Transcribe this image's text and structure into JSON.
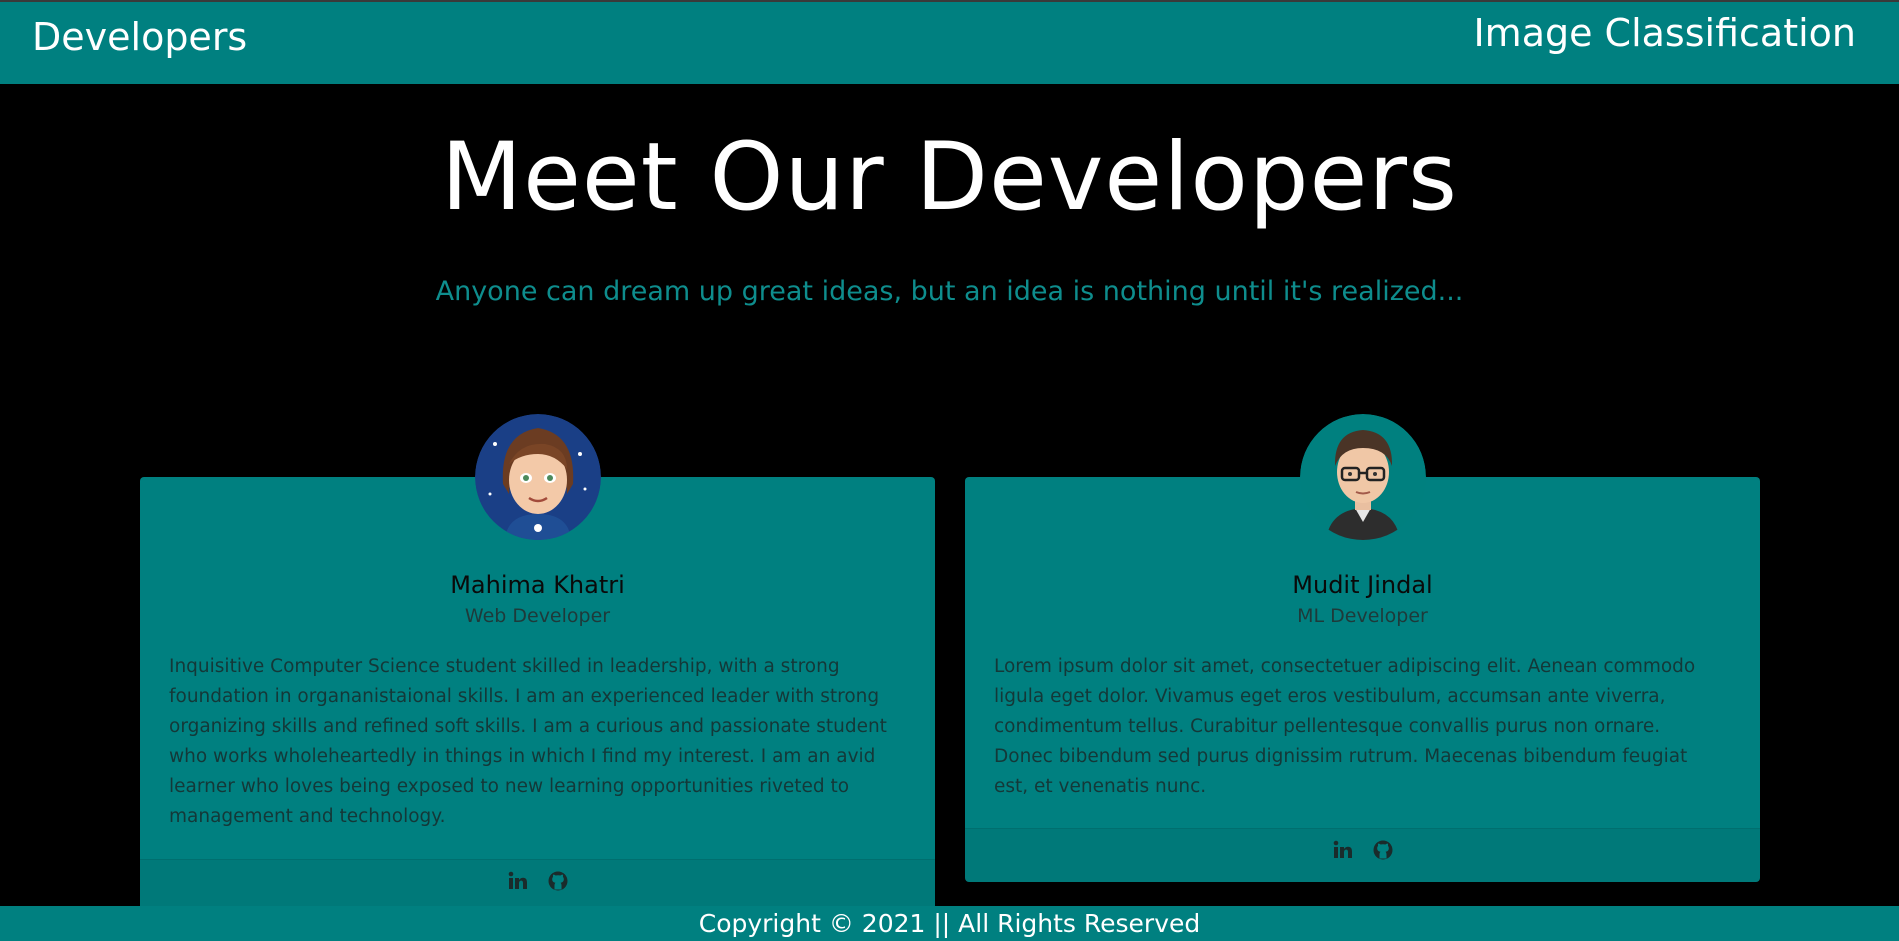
{
  "header": {
    "brand": "Developers",
    "nav_title": "Image Classification"
  },
  "hero": {
    "title": "Meet Our Developers",
    "subtitle": "Anyone can dream up great ideas, but an idea is nothing until it's realized..."
  },
  "developers": [
    {
      "name": "Mahima Khatri",
      "role": "Web Developer",
      "bio": "Inquisitive Computer Science student skilled in leadership, with a strong foundation in organanistaional skills. I am an experienced leader with strong organizing skills and refined soft skills. I am a curious and passionate student who works wholeheartedly in things in which I find my interest. I am an avid learner who loves being exposed to new learning opportunities riveted to management and technology.",
      "avatar_icon": "female-avatar-icon",
      "links": [
        "linkedin-icon",
        "github-icon"
      ]
    },
    {
      "name": "Mudit Jindal",
      "role": "ML Developer",
      "bio": "Lorem ipsum dolor sit amet, consectetuer adipiscing elit. Aenean commodo ligula eget dolor. Vivamus eget eros vestibulum, accumsan ante viverra, condimentum tellus. Curabitur pellentesque convallis purus non ornare. Donec bibendum sed purus dignissim rutrum. Maecenas bibendum feugiat est, et venenatis nunc.",
      "avatar_icon": "male-avatar-icon",
      "links": [
        "linkedin-icon",
        "github-icon"
      ]
    }
  ],
  "footer": {
    "copyright": "Copyright © 2021 || All Rights Reserved"
  },
  "colors": {
    "accent": "#008080",
    "background": "#000000",
    "subtitle": "#0e8d8d"
  }
}
